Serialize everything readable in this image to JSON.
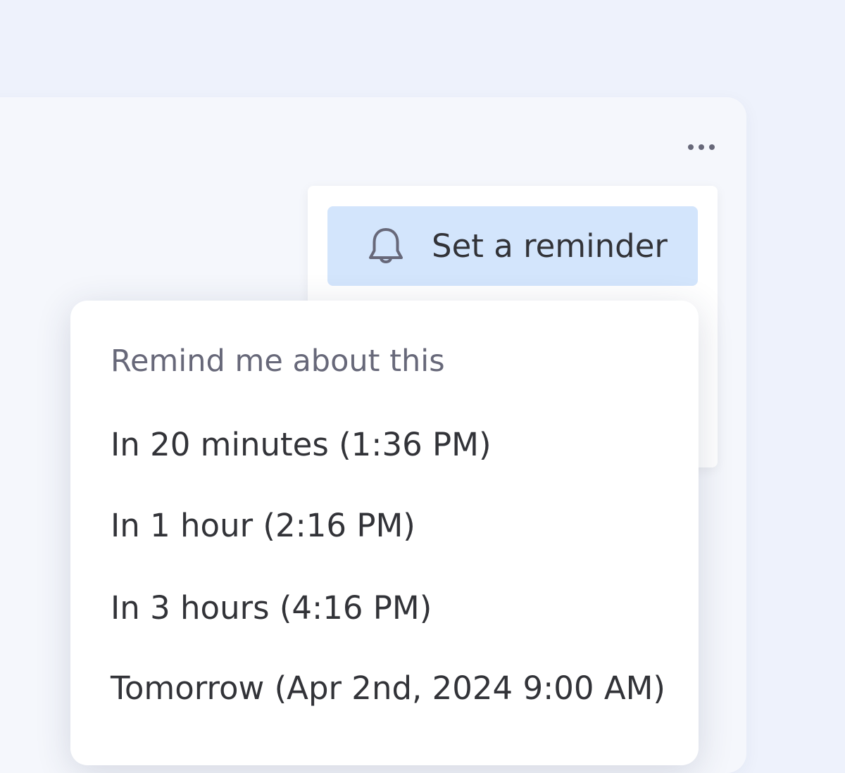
{
  "menu": {
    "more_icon": "ellipsis-horizontal-icon",
    "reminder_button": {
      "icon": "bell-icon",
      "label": "Set a reminder"
    }
  },
  "reminder_panel": {
    "heading": "Remind me about this",
    "options": [
      "In 20 minutes (1:36 PM)",
      "In 1 hour (2:16 PM)",
      "In 3 hours (4:16 PM)",
      "Tomorrow (Apr 2nd, 2024 9:00 AM)"
    ]
  },
  "colors": {
    "page_background": "#eef2fc",
    "reminder_button_bg": "#d3e5fc",
    "primary_text": "#323338",
    "secondary_text": "#676879"
  }
}
